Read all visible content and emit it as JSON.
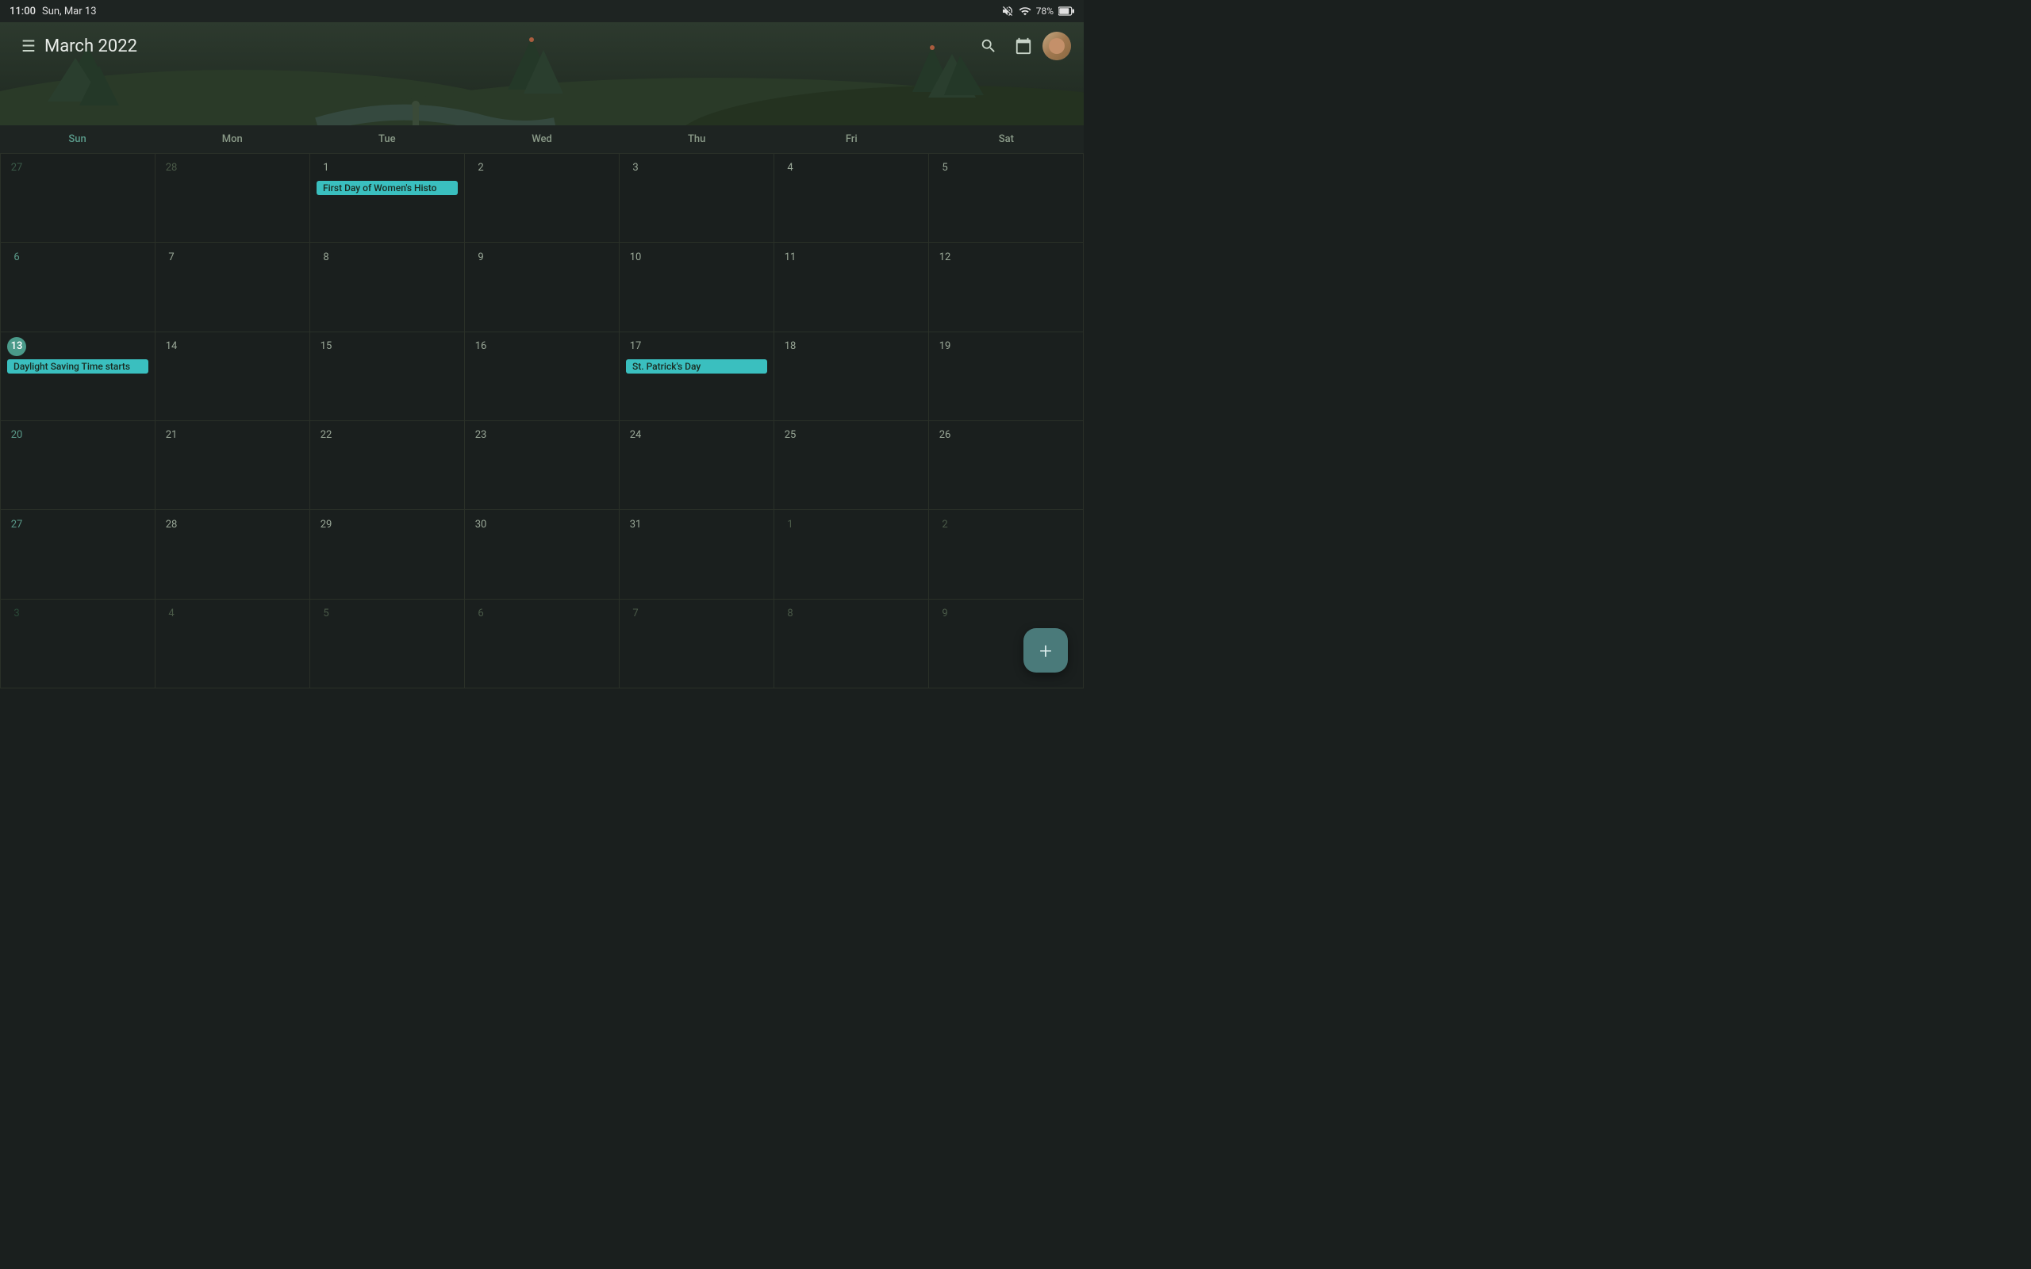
{
  "status": {
    "time": "11:00",
    "date": "Sun, Mar 13",
    "battery": "78%",
    "battery_icon": "🔋"
  },
  "header": {
    "title": "March 2022",
    "menu_label": "☰",
    "search_label": "🔍",
    "calendar_today_label": "▦"
  },
  "day_headers": [
    "Sun",
    "Mon",
    "Tue",
    "Wed",
    "Thu",
    "Fri",
    "Sat"
  ],
  "calendar": {
    "weeks": [
      [
        {
          "date": "27",
          "other": true
        },
        {
          "date": "28",
          "other": true
        },
        {
          "date": "1",
          "events": [
            {
              "label": "First Day of Women's Histo",
              "color": "teal"
            }
          ]
        },
        {
          "date": "2"
        },
        {
          "date": "3"
        },
        {
          "date": "4"
        },
        {
          "date": "5"
        }
      ],
      [
        {
          "date": "6"
        },
        {
          "date": "7"
        },
        {
          "date": "8"
        },
        {
          "date": "9"
        },
        {
          "date": "10"
        },
        {
          "date": "11"
        },
        {
          "date": "12"
        }
      ],
      [
        {
          "date": "13",
          "today": true,
          "events": [
            {
              "label": "Daylight Saving Time starts",
              "color": "teal"
            }
          ]
        },
        {
          "date": "14"
        },
        {
          "date": "15"
        },
        {
          "date": "16"
        },
        {
          "date": "17",
          "events": [
            {
              "label": "St. Patrick's Day",
              "color": "teal"
            }
          ]
        },
        {
          "date": "18"
        },
        {
          "date": "19"
        }
      ],
      [
        {
          "date": "20"
        },
        {
          "date": "21"
        },
        {
          "date": "22"
        },
        {
          "date": "23"
        },
        {
          "date": "24"
        },
        {
          "date": "25"
        },
        {
          "date": "26"
        }
      ],
      [
        {
          "date": "27"
        },
        {
          "date": "28"
        },
        {
          "date": "29"
        },
        {
          "date": "30"
        },
        {
          "date": "31"
        },
        {
          "date": "1",
          "other": true
        },
        {
          "date": "2",
          "other": true
        }
      ],
      [
        {
          "date": "3",
          "other": true
        },
        {
          "date": "4",
          "other": true
        },
        {
          "date": "5",
          "other": true
        },
        {
          "date": "6",
          "other": true
        },
        {
          "date": "7",
          "other": true
        },
        {
          "date": "8",
          "other": true
        },
        {
          "date": "9",
          "other": true
        }
      ]
    ]
  },
  "fab": {
    "label": "+"
  }
}
